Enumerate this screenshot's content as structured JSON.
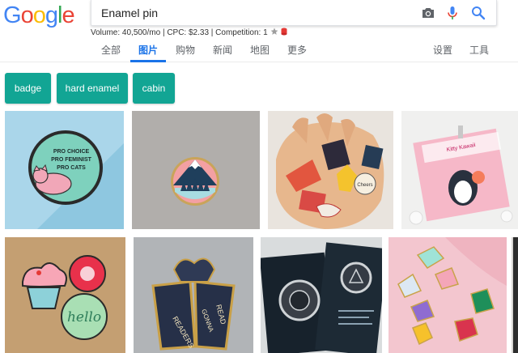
{
  "logo": {
    "letters": [
      "G",
      "o",
      "o",
      "g",
      "l",
      "e"
    ],
    "colors": [
      "#4285F4",
      "#EA4335",
      "#FBBC05",
      "#4285F4",
      "#34A853",
      "#EA4335"
    ]
  },
  "search": {
    "value": "Enamel pin",
    "placeholder": ""
  },
  "keyword_stats": {
    "text": "Volume: 40,500/mo | CPC: $2.33 | Competition: 1"
  },
  "tabs": [
    {
      "label": "全部"
    },
    {
      "label": "图片"
    },
    {
      "label": "购物"
    },
    {
      "label": "新闻"
    },
    {
      "label": "地图"
    },
    {
      "label": "更多"
    },
    {
      "label": "设置"
    },
    {
      "label": "工具"
    }
  ],
  "chips": [
    {
      "label": "badge"
    },
    {
      "label": "hard enamel"
    },
    {
      "label": "cabin"
    }
  ],
  "pins": {
    "cat": {
      "lines": [
        "PRO CHOICE",
        "PRO FEMINIST",
        "PRO CATS"
      ]
    },
    "book_pin": {
      "text": "Cheers"
    },
    "book_text": {
      "left": "READERS",
      "center": "GONNA",
      "right": "READ"
    },
    "hello": {
      "text": "hello"
    },
    "kitty": {
      "header": "Kitty Kawaii"
    }
  },
  "colors": {
    "accent": "#1a73e8",
    "chip": "#12a594"
  }
}
